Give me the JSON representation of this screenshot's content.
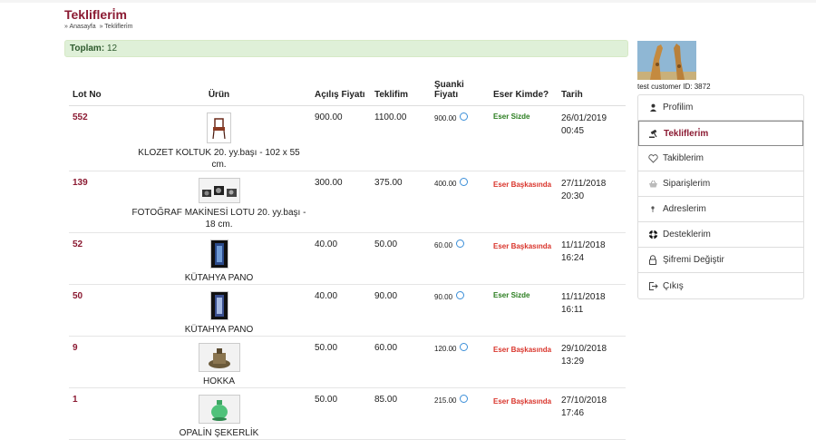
{
  "page": {
    "title": "Teklifleri̇m",
    "breadcrumb": [
      "» Anasayfa",
      "» Teklifleri̇m"
    ]
  },
  "total": {
    "label": "Toplam:",
    "value": "12"
  },
  "table": {
    "headers": {
      "lot": "Lot No",
      "urun": "Ürün",
      "acilis": "Açılış Fiyatı",
      "teklif": "Teklifim",
      "suanki_1": "Şuanki",
      "suanki_2": "Fiyatı",
      "kimde": "Eser Kimde?",
      "tarih": "Tarih"
    },
    "rows": [
      {
        "lot": "552",
        "urun": "KLOZET KOLTUK 20. yy.başı - 102 x 55 cm.",
        "acilis": "900.00",
        "teklif": "1100.00",
        "suanki": "900.00",
        "kimde": "Eser Sizde",
        "kimde_win": true,
        "tarih_1": "26/01/2019",
        "tarih_2": "00:45"
      },
      {
        "lot": "139",
        "urun": "FOTOĞRAF MAKİNESİ LOTU 20. yy.başı - 18 cm.",
        "acilis": "300.00",
        "teklif": "375.00",
        "suanki": "400.00",
        "kimde": "Eser Başkasında",
        "kimde_win": false,
        "tarih_1": "27/11/2018",
        "tarih_2": "20:30"
      },
      {
        "lot": "52",
        "urun": "KÜTAHYA PANO",
        "acilis": "40.00",
        "teklif": "50.00",
        "suanki": "60.00",
        "kimde": "Eser Başkasında",
        "kimde_win": false,
        "tarih_1": "11/11/2018",
        "tarih_2": "16:24"
      },
      {
        "lot": "50",
        "urun": "KÜTAHYA PANO",
        "acilis": "40.00",
        "teklif": "90.00",
        "suanki": "90.00",
        "kimde": "Eser Sizde",
        "kimde_win": true,
        "tarih_1": "11/11/2018",
        "tarih_2": "16:11"
      },
      {
        "lot": "9",
        "urun": "HOKKA",
        "acilis": "50.00",
        "teklif": "60.00",
        "suanki": "120.00",
        "kimde": "Eser Başkasında",
        "kimde_win": false,
        "tarih_1": "29/10/2018",
        "tarih_2": "13:29"
      },
      {
        "lot": "1",
        "urun": "OPALİN ŞEKERLİK",
        "acilis": "50.00",
        "teklif": "85.00",
        "suanki": "215.00",
        "kimde": "Eser Başkasında",
        "kimde_win": false,
        "tarih_1": "27/10/2018",
        "tarih_2": "17:46"
      }
    ]
  },
  "customer": {
    "name": "test customer",
    "id_label": "ID:",
    "id": "3872"
  },
  "menu": [
    {
      "label": "Profilim",
      "icon": "user-icon",
      "active": false
    },
    {
      "label": "Teklifleri̇m",
      "icon": "gavel-icon",
      "active": true
    },
    {
      "label": "Takiblerim",
      "icon": "heart-icon",
      "active": false
    },
    {
      "label": "Siparişlerim",
      "icon": "basket-icon",
      "active": false
    },
    {
      "label": "Adreslerim",
      "icon": "pin-icon",
      "active": false
    },
    {
      "label": "Desteklerim",
      "icon": "lifebuoy-icon",
      "active": false
    },
    {
      "label": "Şifremi Değiştir",
      "icon": "lock-icon",
      "active": false
    },
    {
      "label": "Çıkış",
      "icon": "logout-icon",
      "active": false
    }
  ],
  "colors": {
    "brand": "#8b1a32",
    "win": "#2a7d1f",
    "lose": "#d9342b",
    "total_bg": "#dff0d8"
  }
}
